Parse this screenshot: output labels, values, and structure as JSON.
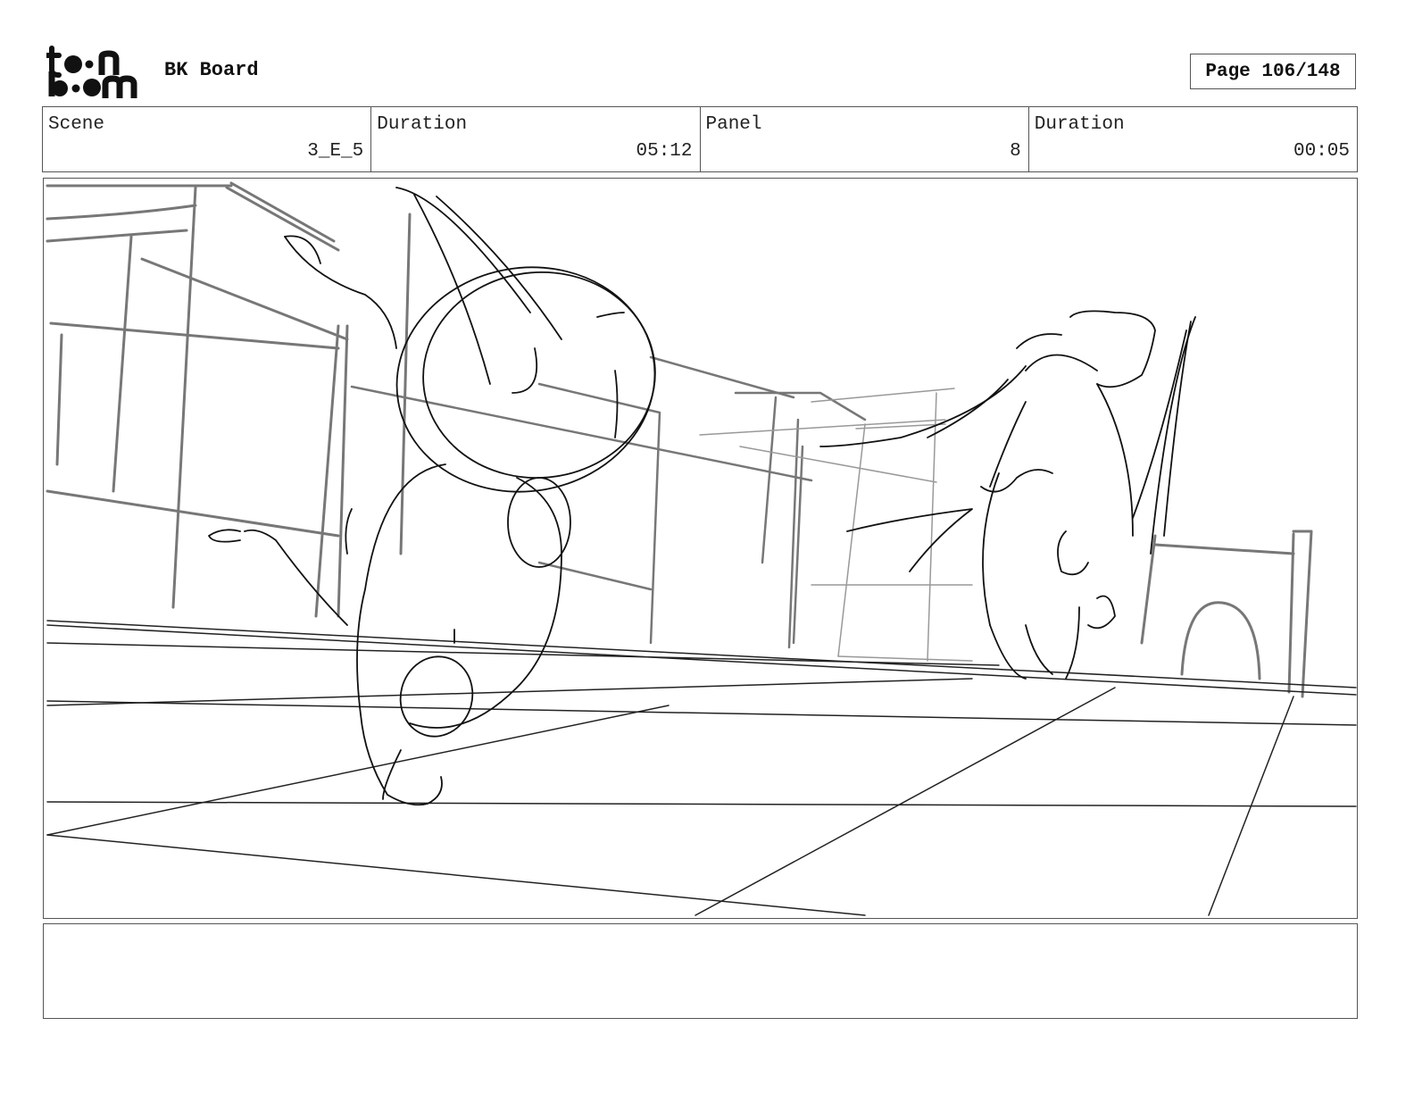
{
  "header": {
    "logo_text": "toon boom",
    "board_title": "BK Board",
    "page_label": "Page 106/148"
  },
  "info": [
    {
      "label": "Scene",
      "value": "3_E_5"
    },
    {
      "label": "Duration",
      "value": "05:12"
    },
    {
      "label": "Panel",
      "value": "8"
    },
    {
      "label": "Duration",
      "value": "00:05"
    }
  ],
  "panel": {
    "sketch": "pencil storyboard sketch"
  },
  "notes": {
    "text": ""
  }
}
